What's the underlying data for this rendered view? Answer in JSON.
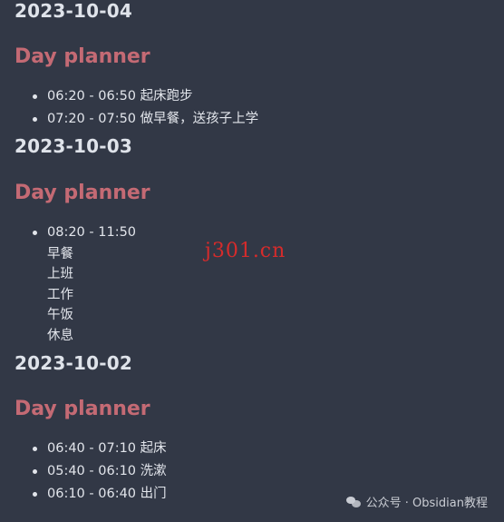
{
  "days": [
    {
      "date": "2023-10-04",
      "section": "Day planner",
      "entries": [
        {
          "time": "06:20 - 06:50",
          "text": "起床跑步"
        },
        {
          "time": "07:20 - 07:50",
          "text": "做早餐，送孩子上学"
        }
      ]
    },
    {
      "date": "2023-10-03",
      "section": "Day planner",
      "entries": [
        {
          "time": "08:20 - 11:50",
          "lines": [
            "早餐",
            "上班",
            "工作",
            "午饭",
            "休息"
          ]
        }
      ]
    },
    {
      "date": "2023-10-02",
      "section": "Day planner",
      "entries": [
        {
          "time": "06:40 - 07:10",
          "text": "起床"
        },
        {
          "time": "05:40 - 06:10",
          "text": "洗漱"
        },
        {
          "time": "06:10 - 06:40",
          "text": "出门"
        }
      ]
    }
  ],
  "watermark": "j301.cn",
  "footer": {
    "icon": "wechat-icon",
    "text": "公众号 · Obsidian教程"
  }
}
